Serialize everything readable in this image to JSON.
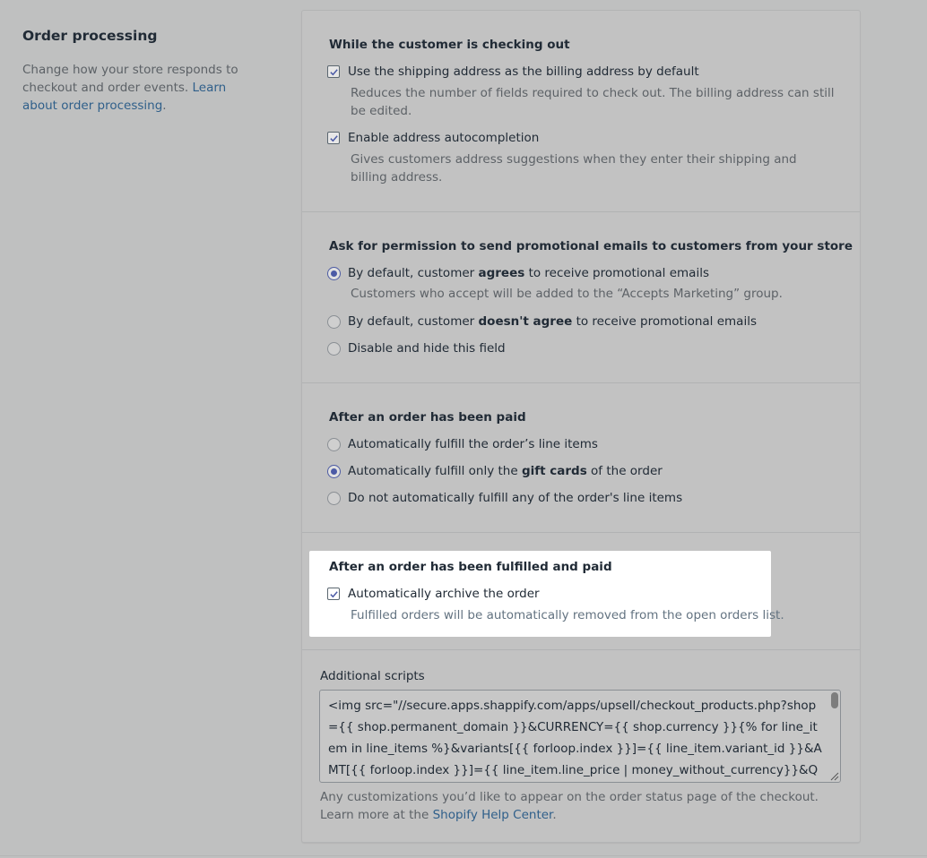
{
  "sidebar": {
    "title": "Order processing",
    "description": "Change how your store responds to checkout and order events.",
    "link": "Learn about order processing"
  },
  "checkout": {
    "title": "While the customer is checking out",
    "shipping_label": "Use the shipping address as the billing address by default",
    "shipping_help": "Reduces the number of fields required to check out. The billing address can still be edited.",
    "autocomplete_label": "Enable address autocompletion",
    "autocomplete_help": "Gives customers address suggestions when they enter their shipping and billing address."
  },
  "promo": {
    "title": "Ask for permission to send promotional emails to customers from your store",
    "opt1_pre": "By default, customer",
    "opt1_bold": "agrees",
    "opt1_post": "to receive promotional emails",
    "opt1_help": "Customers who accept will be added to the “Accepts Marketing” group.",
    "opt2_pre": "By default, customer",
    "opt2_bold": "doesn't agree",
    "opt2_post": "to receive promotional emails",
    "opt3": "Disable and hide this field"
  },
  "paid": {
    "title": "After an order has been paid",
    "opt1": "Automatically fulfill the order’s line items",
    "opt2_pre": "Automatically fulfill only the",
    "opt2_bold": "gift cards",
    "opt2_post": "of the order",
    "opt3": "Do not automatically fulfill any of the order's line items"
  },
  "fulfilled": {
    "title": "After an order has been fulfilled and paid",
    "archive_label": "Automatically archive the order",
    "archive_help": "Fulfilled orders will be automatically removed from the open orders list."
  },
  "scripts": {
    "label": "Additional scripts",
    "value": "<img src=\"//secure.apps.shappify.com/apps/upsell/checkout_products.php?shop={{ shop.permanent_domain }}&CURRENCY={{ shop.currency }}{% for line_item in line_items %}&variants[{{ forloop.index }}]={{ line_item.variant_id }}&AMT[{{ forloop.index }}]={{ line_item.line_price | money_without_currency}}&QTY[{{",
    "help": "Any customizations you’d like to appear on the order status page of the checkout. Learn more at the",
    "help_link": "Shopify Help Center"
  },
  "colors": {
    "accent": "#4b5aa6",
    "link": "#2f5f8a",
    "overlay": "#bfc0c0",
    "spotlight": "#ffffff"
  }
}
